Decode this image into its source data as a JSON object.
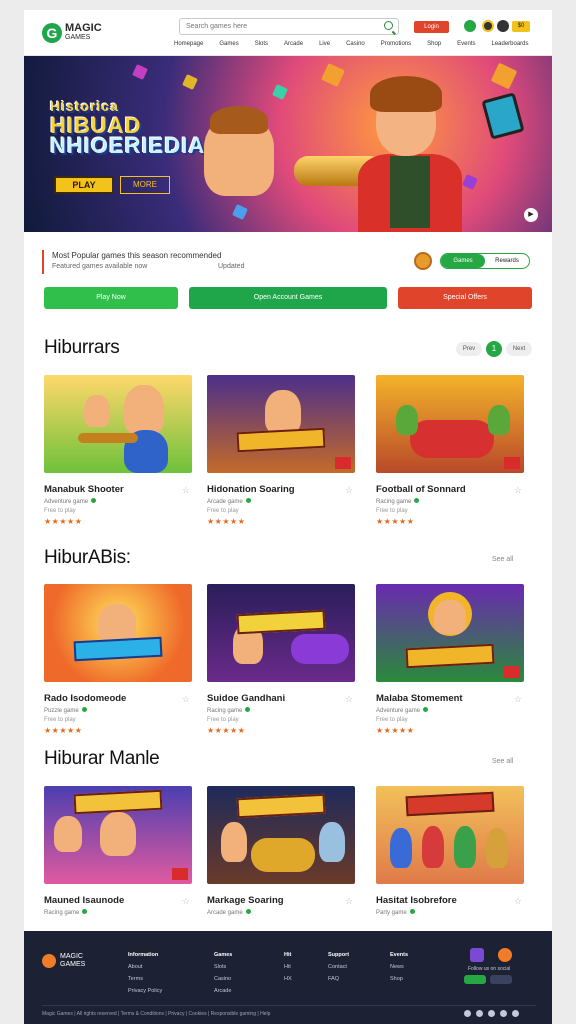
{
  "header": {
    "logo_mark": "G",
    "logo_line1": "MAGIC",
    "logo_line2": "GAMES",
    "search_placeholder": "Search games here",
    "login_label": "Login",
    "badge_label": "$0",
    "nav": [
      "Homepage",
      "Games",
      "Slots",
      "Arcade",
      "Live",
      "Casino",
      "Promotions",
      "Shop",
      "Events",
      "Leaderboards"
    ]
  },
  "hero": {
    "line1": "Historica",
    "line2": "HIBUAD",
    "line3": "NHIOERIEDIAN",
    "chip1": "PLAY",
    "chip2": "MORE"
  },
  "info": {
    "line1": "Most Popular games this season recommended",
    "line2": "Featured games available now",
    "line3": "Updated",
    "toggle_on": "Games",
    "toggle_off": "Rewards"
  },
  "actions": {
    "primary": "Play Now",
    "secondary": "Open Account Games",
    "tertiary": "Special Offers"
  },
  "sections": [
    {
      "title": "Hiburrars",
      "pager_prev": "Prev",
      "pager_num": "1",
      "pager_next": "Next",
      "more": "",
      "cards": [
        {
          "title": "Manabuk Shooter",
          "sub": "Adventure game",
          "sub2": "Free to play",
          "rating": "★★★★★"
        },
        {
          "title": "Hidonation Soaring",
          "sub": "Arcade game",
          "sub2": "Free to play",
          "rating": "★★★★★"
        },
        {
          "title": "Football of Sonnard",
          "sub": "Racing game",
          "sub2": "Free to play",
          "rating": "★★★★★"
        }
      ]
    },
    {
      "title": "HiburABis:",
      "more": "See all",
      "cards": [
        {
          "title": "Rado Isodomeode",
          "sub": "Puzzle game",
          "sub2": "Free to play",
          "rating": "★★★★★"
        },
        {
          "title": "Suidoe Gandhani",
          "sub": "Racing game",
          "sub2": "Free to play",
          "rating": "★★★★★"
        },
        {
          "title": "Malaba Stomement",
          "sub": "Adventure game",
          "sub2": "Free to play",
          "rating": "★★★★★"
        }
      ]
    },
    {
      "title": "Hiburar Manle",
      "more": "See all",
      "cards": [
        {
          "title": "Mauned Isaunode",
          "sub": "Racing game"
        },
        {
          "title": "Markage Soaring",
          "sub": "Arcade game"
        },
        {
          "title": "Hasitat Isobrefore",
          "sub": "Party game"
        }
      ]
    }
  ],
  "footer": {
    "logo_line1": "MAGIC",
    "logo_line2": "GAMES",
    "col1": [
      "Information",
      "About",
      "Terms",
      "Privacy Policy"
    ],
    "col2": [
      "Games",
      "Slots",
      "Casino",
      "Arcade"
    ],
    "col3": [
      "Hit",
      "Hit",
      "HX"
    ],
    "col4": [
      "Support",
      "Contact",
      "FAQ"
    ],
    "col5": [
      "Events",
      "News",
      "Shop"
    ],
    "follow": "Follow us on social",
    "copyright": "Magic Games | All rights reserved | Terms & Conditions | Privacy | Cookies | Responsible gaming | Help"
  },
  "colors": {
    "brand_green": "#25a843",
    "accent_red": "#e0442a",
    "footer_bg": "#1c2233",
    "rating": "#e56a1d"
  }
}
